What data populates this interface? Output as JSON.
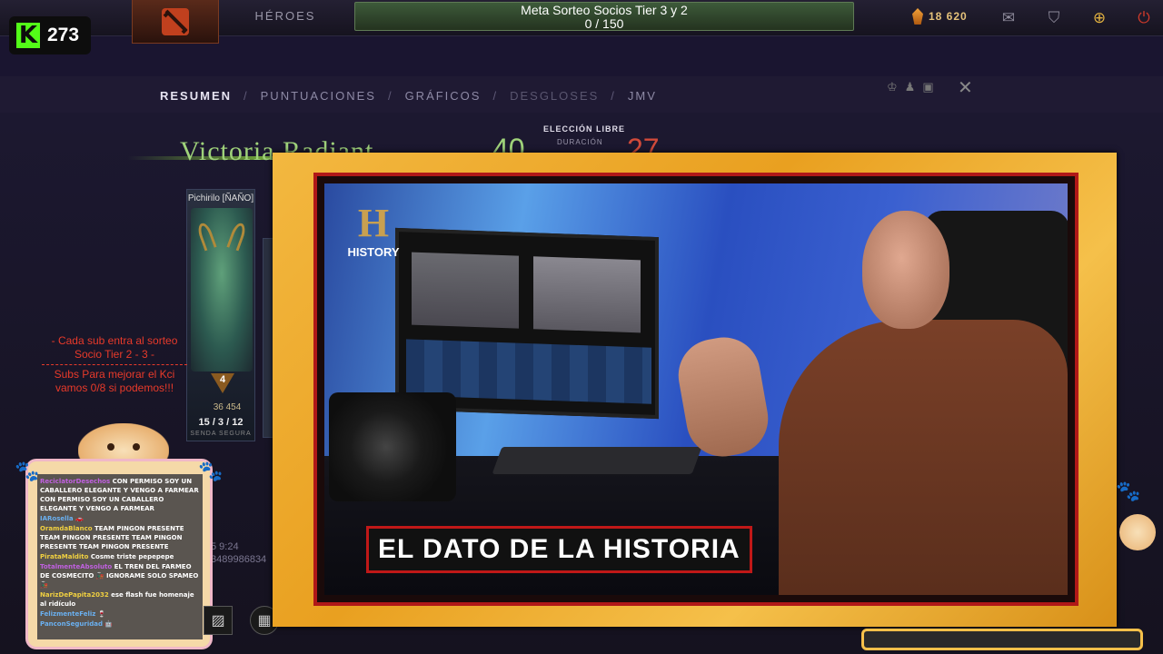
{
  "topbar": {
    "tab_heroes": "HÉROES",
    "meta_title": "Meta Sorteo Socios Tier 3 y 2",
    "meta_progress": "0 / 150",
    "currency_amount": "18 620"
  },
  "kick": {
    "viewer_count": "273"
  },
  "postgame_nav": {
    "items": [
      "RESUMEN",
      "PUNTUACIONES",
      "GRÁFICOS",
      "DESGLOSES",
      "JMV"
    ],
    "separator": "/"
  },
  "match": {
    "result": "Victoria Radiant",
    "score_radiant": "40",
    "score_dire": "27",
    "mode": "ELECCIÓN LIBRE",
    "duration_label": "DURACIÓN"
  },
  "hero_card": {
    "player": "Pichirilo [ÑAÑO]",
    "rank": "4",
    "networth": "36 454",
    "kda": "15 / 3 / 12",
    "role": "SENDA SEGURA"
  },
  "sub_notice": {
    "line1": "- Cada sub entra al sorteo",
    "line2": "Socio Tier 2 - 3 -",
    "line3": "Subs Para mejorar el Kci",
    "line4": "vamos 0/8 si podemos!!!"
  },
  "leftover": {
    "time": "5 9:24",
    "id": "3489986834"
  },
  "chat": {
    "messages": [
      {
        "user": "ReciclatorDesechos",
        "text": "CON PERMISO SOY UN CABALLERO ELEGANTE Y VENGO A FARMEAR CON PERMISO SOY UN CABALLERO ELEGANTE Y VENGO A FARMEAR"
      },
      {
        "user": "IARosella",
        "text": "🚗"
      },
      {
        "user": "OramdaBlanco",
        "text": "TEAM PINGON PRESENTE TEAM PINGON PRESENTE TEAM PINGON PRESENTE TEAM PINGON PRESENTE"
      },
      {
        "user": "PirataMaldito",
        "text": "Cosme triste pepepepe"
      },
      {
        "user": "TotalmenteAbsoluto",
        "text": "EL TREN DEL FARMEO DE COSMECITO 🚂 IGNORAME SOLO SPAMEO 🚂"
      },
      {
        "user": "NarizDePapita2032",
        "text": "ese flash fue homenaje al ridículo"
      },
      {
        "user": "FelizmenteFeliz",
        "text": "🍷"
      },
      {
        "user": "PanconSeguridad",
        "text": "🤖"
      }
    ]
  },
  "video": {
    "channel": "HISTORY",
    "caption": "EL DATO DE LA HISTORIA"
  },
  "colors": {
    "accent_green": "#9fd27a",
    "dire_red": "#d04a3a",
    "kick_green": "#53fc18",
    "frame_gold": "#f3b840",
    "caption_red": "#c01818"
  },
  "icons": [
    "dota-logo-icon",
    "shard-icon",
    "mail-icon",
    "armory-icon",
    "plus-icon",
    "power-icon",
    "crown-icon",
    "close-icon",
    "history-logo-icon"
  ]
}
